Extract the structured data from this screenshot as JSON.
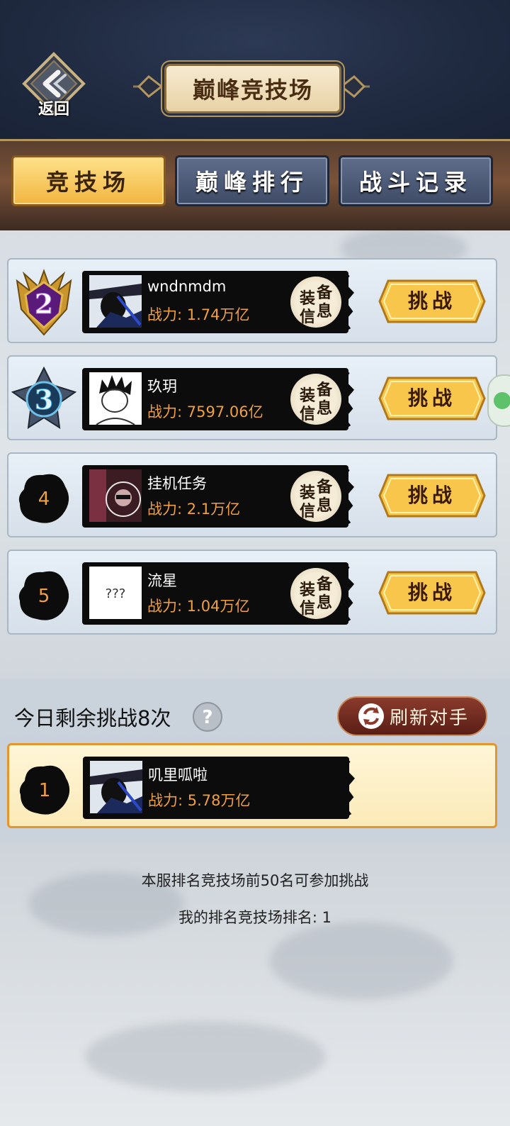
{
  "header": {
    "back_label": "返回",
    "title": "巅峰竞技场"
  },
  "tabs": [
    {
      "label": "竞技场",
      "active": true
    },
    {
      "label": "巅峰排行",
      "active": false
    },
    {
      "label": "战斗记录",
      "active": false
    }
  ],
  "opponents": [
    {
      "rank": "2",
      "name": "wndnmdm",
      "power": "战力: 1.74万亿",
      "equip_label": [
        "装",
        "备",
        "信",
        "息"
      ],
      "challenge_label": "挑战"
    },
    {
      "rank": "3",
      "name": "玖玥",
      "power": "战力: 7597.06亿",
      "equip_label": [
        "装",
        "备",
        "信",
        "息"
      ],
      "challenge_label": "挑战"
    },
    {
      "rank": "4",
      "name": "挂机任务",
      "power": "战力: 2.1万亿",
      "equip_label": [
        "装",
        "备",
        "信",
        "息"
      ],
      "challenge_label": "挑战"
    },
    {
      "rank": "5",
      "name": "流星",
      "power": "战力: 1.04万亿",
      "equip_label": [
        "装",
        "备",
        "信",
        "息"
      ],
      "challenge_label": "挑战",
      "avatar_text": "???"
    }
  ],
  "challenges": {
    "remaining_text": "今日剩余挑战8次",
    "help_label": "?",
    "refresh_label": "刷新对手"
  },
  "my_entry": {
    "rank": "1",
    "name": "叽里呱啦",
    "power": "战力: 5.78万亿"
  },
  "footer": {
    "line1": "本服排名竞技场前50名可参加挑战",
    "line2": "我的排名竞技场排名: 1"
  },
  "colors": {
    "power": "#f0a040",
    "active_tab": "#f2b53f",
    "challenge_button": "#f7c64a"
  }
}
